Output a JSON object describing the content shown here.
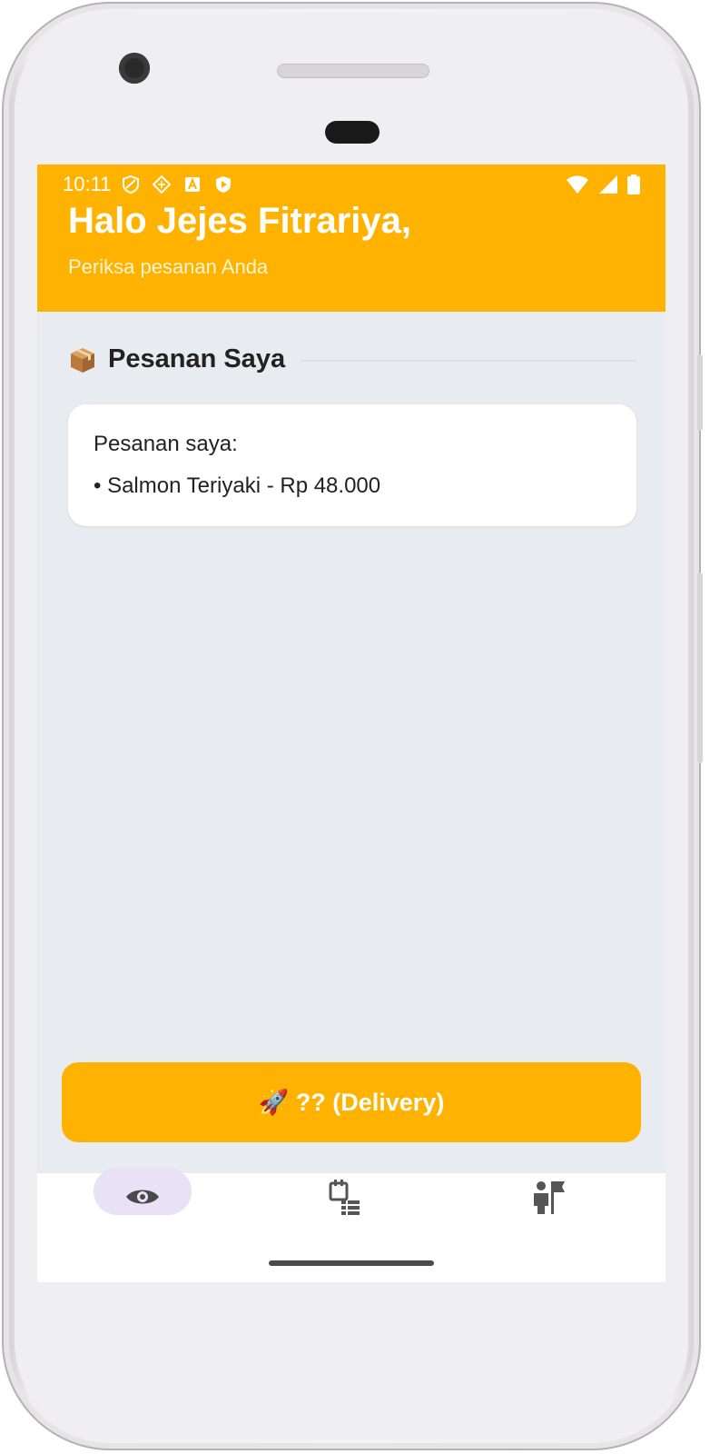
{
  "status_bar": {
    "time": "10:11"
  },
  "header": {
    "greeting": "Halo Jejes Fitrariya,",
    "subtitle": "Periksa pesanan Anda",
    "color": "#ffb300"
  },
  "section": {
    "icon": "package-icon",
    "title": "Pesanan Saya"
  },
  "order_card": {
    "title": "Pesanan saya:",
    "items": [
      "• Salmon Teriyaki - Rp 48.000"
    ]
  },
  "delivery_button": {
    "label": "🚀 ?? (Delivery)"
  },
  "bottom_nav": {
    "items": [
      {
        "icon": "eye-icon",
        "active": true
      },
      {
        "icon": "calendar-list-icon",
        "active": false
      },
      {
        "icon": "person-flag-icon",
        "active": false
      }
    ]
  }
}
